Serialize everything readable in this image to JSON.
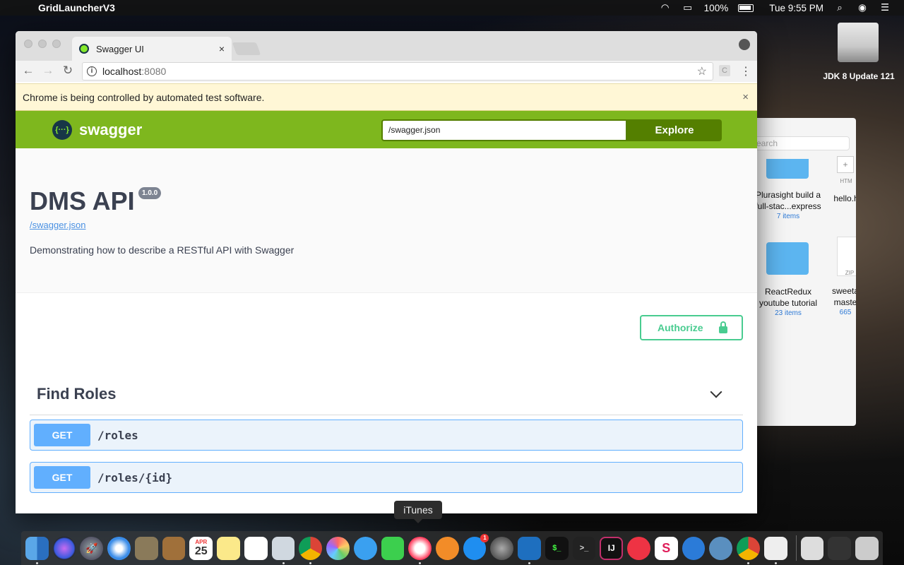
{
  "menubar": {
    "app_name": "GridLauncherV3",
    "battery_percent": "100%",
    "clock": "Tue 9:55 PM"
  },
  "desktop": {
    "drive_label": "JDK 8 Update 121"
  },
  "finder": {
    "search_placeholder": "earch",
    "plus": "+",
    "html_label": "HTM",
    "zip_label": "ZIP",
    "items": [
      {
        "name_line1": "Plurasight build a",
        "name_line2": "full-stac...express",
        "count": "7 items"
      },
      {
        "name_line1": "hello.h",
        "name_line2": "",
        "count": ""
      },
      {
        "name_line1": "ReactRedux",
        "name_line2": "youtube tutorial",
        "count": "23 items"
      },
      {
        "name_line1": "sweeta",
        "name_line2": "maste",
        "count": "665"
      }
    ]
  },
  "browser": {
    "tab_title": "Swagger UI",
    "tab_close": "×",
    "url_host": "localhost",
    "url_port": ":8080",
    "ext_label": "C",
    "infobar_text": "Chrome is being controlled by automated test software.",
    "infobar_close": "×"
  },
  "swagger": {
    "logo_text": "swagger",
    "logo_glyph": "{···}",
    "spec_url_value": "/swagger.json",
    "explore_label": "Explore",
    "api_title": "DMS API",
    "api_version": "1.0.0",
    "spec_link": "/swagger.json",
    "description": "Demonstrating how to describe a RESTful API with Swagger",
    "authorize_label": "Authorize",
    "tag_name": "Find Roles",
    "operations": [
      {
        "method": "GET",
        "path": "/roles"
      },
      {
        "method": "GET",
        "path": "/roles/{id}"
      }
    ]
  },
  "tooltip": {
    "text": "iTunes"
  },
  "dock": {
    "calendar_month": "APR",
    "calendar_day": "25",
    "appstore_badge": "1",
    "terminal1": "$_",
    "terminal2": ">_",
    "intellij": "IJ",
    "slack": "S"
  },
  "colors": {
    "swagger_green": "#7eb71e",
    "get_blue": "#61affe",
    "authorize_green": "#49cc90",
    "infobar_bg": "#fff7d6"
  }
}
